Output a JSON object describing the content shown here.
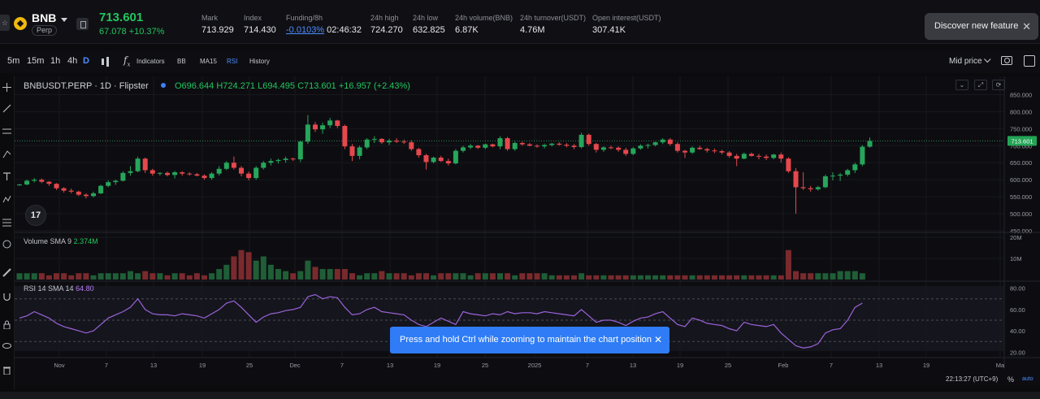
{
  "header": {
    "symbol": "BNB",
    "badge": "Perp",
    "last_price": "713.601",
    "change": "67.078 +10.37%",
    "stats": [
      {
        "label": "Mark",
        "value": "713.929"
      },
      {
        "label": "Index",
        "value": "714.430"
      },
      {
        "label": "Funding/8h",
        "value_link": "-0.0103%",
        "value": "02:46:32"
      },
      {
        "label": "24h high",
        "value": "724.270"
      },
      {
        "label": "24h low",
        "value": "632.825"
      },
      {
        "label": "24h volume(BNB)",
        "value": "6.87K"
      },
      {
        "label": "24h turnover(USDT)",
        "value": "4.76M"
      },
      {
        "label": "Open interest(USDT)",
        "value": "307.41K"
      }
    ],
    "discover": "Discover new feature"
  },
  "toolbar": {
    "intervals": [
      "5m",
      "15m",
      "1h",
      "4h",
      "D"
    ],
    "active_interval": "D",
    "indicators": "Indicators",
    "studies": [
      "BB",
      "MA15",
      "RSI"
    ],
    "active_study": "RSI",
    "history": "History",
    "mid_price": "Mid price"
  },
  "chart": {
    "title": "BNBUSDT.PERP · 1D · Flipster",
    "ohlc": {
      "o": "O696.644",
      "h": "H724.271",
      "l": "L694.495",
      "c": "C713.601",
      "chg": "+16.957 (+2.43%)"
    },
    "volume_label": "Volume SMA 9",
    "volume_value": "2.374M",
    "rsi_label": "RSI 14 SMA 14",
    "rsi_value": "64.80",
    "price_axis": [
      "850.000",
      "800.000",
      "750.000",
      "700.000",
      "650.000",
      "600.000",
      "550.000",
      "500.000",
      "450.000"
    ],
    "current_price_tag": "713.601",
    "volume_axis": [
      "20M",
      "10M"
    ],
    "rsi_axis": [
      "80.00",
      "60.00",
      "40.00",
      "20.00"
    ],
    "x_axis": [
      "Nov",
      "7",
      "13",
      "19",
      "25",
      "Dec",
      "7",
      "13",
      "19",
      "25",
      "2025",
      "7",
      "13",
      "19",
      "25",
      "Feb",
      "7",
      "13",
      "19",
      "Ma"
    ],
    "logo": "17"
  },
  "toast": {
    "text": "Press and hold Ctrl while zooming to maintain the chart position"
  },
  "bottom": {
    "time": "22:13:27 (UTC+9)",
    "percent": "%",
    "auto": "auto"
  },
  "colors": {
    "up": "#26a65b",
    "down": "#e5484d",
    "rsi": "#9b63d9",
    "accent": "#2f7cf6"
  },
  "chart_data": {
    "type": "candlestick",
    "candles": [
      [
        585,
        588,
        582,
        586
      ],
      [
        586,
        600,
        584,
        597
      ],
      [
        597,
        605,
        592,
        600
      ],
      [
        600,
        604,
        590,
        594
      ],
      [
        594,
        596,
        582,
        588
      ],
      [
        588,
        590,
        570,
        575
      ],
      [
        575,
        578,
        562,
        568
      ],
      [
        568,
        574,
        560,
        565
      ],
      [
        565,
        568,
        552,
        556
      ],
      [
        556,
        560,
        545,
        552
      ],
      [
        552,
        565,
        548,
        560
      ],
      [
        560,
        585,
        558,
        582
      ],
      [
        582,
        598,
        578,
        593
      ],
      [
        593,
        600,
        585,
        597
      ],
      [
        597,
        625,
        595,
        620
      ],
      [
        620,
        640,
        612,
        625
      ],
      [
        625,
        668,
        622,
        662
      ],
      [
        662,
        665,
        620,
        628
      ],
      [
        628,
        632,
        612,
        618
      ],
      [
        618,
        622,
        612,
        620
      ],
      [
        620,
        624,
        610,
        614
      ],
      [
        614,
        626,
        604,
        622
      ],
      [
        622,
        625,
        612,
        618
      ],
      [
        618,
        622,
        612,
        616
      ],
      [
        616,
        620,
        610,
        612
      ],
      [
        612,
        616,
        600,
        605
      ],
      [
        605,
        622,
        600,
        618
      ],
      [
        618,
        640,
        612,
        632
      ],
      [
        632,
        655,
        628,
        650
      ],
      [
        650,
        668,
        630,
        635
      ],
      [
        635,
        640,
        610,
        618
      ],
      [
        618,
        624,
        598,
        605
      ],
      [
        605,
        640,
        600,
        635
      ],
      [
        635,
        655,
        630,
        650
      ],
      [
        650,
        662,
        642,
        655
      ],
      [
        655,
        662,
        648,
        658
      ],
      [
        658,
        668,
        650,
        662
      ],
      [
        662,
        665,
        655,
        660
      ],
      [
        660,
        715,
        652,
        712
      ],
      [
        712,
        790,
        705,
        762
      ],
      [
        762,
        770,
        740,
        748
      ],
      [
        748,
        768,
        735,
        760
      ],
      [
        760,
        782,
        752,
        774
      ],
      [
        774,
        776,
        752,
        758
      ],
      [
        758,
        762,
        690,
        698
      ],
      [
        698,
        705,
        655,
        670
      ],
      [
        670,
        700,
        660,
        695
      ],
      [
        695,
        722,
        690,
        718
      ],
      [
        718,
        728,
        708,
        720
      ],
      [
        720,
        722,
        705,
        710
      ],
      [
        710,
        720,
        702,
        715
      ],
      [
        715,
        722,
        708,
        712
      ],
      [
        712,
        718,
        705,
        710
      ],
      [
        710,
        716,
        685,
        690
      ],
      [
        690,
        694,
        665,
        672
      ],
      [
        672,
        676,
        630,
        652
      ],
      [
        652,
        668,
        648,
        665
      ],
      [
        665,
        670,
        652,
        655
      ],
      [
        655,
        662,
        642,
        648
      ],
      [
        648,
        690,
        645,
        685
      ],
      [
        685,
        700,
        680,
        695
      ],
      [
        695,
        705,
        690,
        700
      ],
      [
        700,
        702,
        690,
        694
      ],
      [
        694,
        706,
        690,
        704
      ],
      [
        704,
        706,
        695,
        698
      ],
      [
        698,
        728,
        690,
        722
      ],
      [
        722,
        726,
        685,
        690
      ],
      [
        690,
        712,
        685,
        708
      ],
      [
        708,
        712,
        700,
        704
      ],
      [
        704,
        708,
        698,
        700
      ],
      [
        700,
        704,
        694,
        698
      ],
      [
        698,
        706,
        692,
        702
      ],
      [
        702,
        708,
        698,
        706
      ],
      [
        706,
        710,
        700,
        703
      ],
      [
        703,
        708,
        695,
        700
      ],
      [
        700,
        705,
        690,
        696
      ],
      [
        696,
        738,
        692,
        732
      ],
      [
        732,
        736,
        700,
        705
      ],
      [
        705,
        708,
        680,
        688
      ],
      [
        688,
        698,
        682,
        695
      ],
      [
        695,
        700,
        690,
        694
      ],
      [
        694,
        698,
        682,
        688
      ],
      [
        688,
        694,
        670,
        676
      ],
      [
        676,
        696,
        672,
        692
      ],
      [
        692,
        704,
        688,
        700
      ],
      [
        700,
        706,
        692,
        702
      ],
      [
        702,
        712,
        698,
        710
      ],
      [
        710,
        722,
        705,
        718
      ],
      [
        718,
        722,
        700,
        705
      ],
      [
        705,
        710,
        680,
        685
      ],
      [
        685,
        688,
        664,
        680
      ],
      [
        680,
        698,
        676,
        694
      ],
      [
        694,
        700,
        688,
        690
      ],
      [
        690,
        694,
        680,
        686
      ],
      [
        686,
        692,
        678,
        684
      ],
      [
        684,
        688,
        675,
        680
      ],
      [
        680,
        684,
        665,
        670
      ],
      [
        670,
        676,
        640,
        662
      ],
      [
        662,
        680,
        660,
        676
      ],
      [
        676,
        680,
        668,
        670
      ],
      [
        670,
        676,
        660,
        668
      ],
      [
        668,
        674,
        658,
        664
      ],
      [
        664,
        676,
        660,
        674
      ],
      [
        674,
        680,
        650,
        662
      ],
      [
        662,
        666,
        620,
        625
      ],
      [
        625,
        634,
        500,
        578
      ],
      [
        578,
        622,
        570,
        575
      ],
      [
        575,
        582,
        565,
        572
      ],
      [
        572,
        582,
        568,
        578
      ],
      [
        578,
        615,
        575,
        610
      ],
      [
        610,
        622,
        598,
        612
      ],
      [
        612,
        620,
        596,
        615
      ],
      [
        615,
        632,
        610,
        628
      ],
      [
        628,
        650,
        620,
        645
      ],
      [
        645,
        702,
        640,
        697
      ],
      [
        697,
        724,
        694,
        714
      ]
    ],
    "volume": [
      3,
      3,
      3,
      3,
      2,
      3,
      3,
      2,
      3,
      3,
      2,
      3,
      3,
      3,
      3,
      4,
      3,
      4,
      3,
      3,
      2,
      3,
      3,
      2,
      3,
      2,
      3,
      5,
      7,
      11,
      14,
      13,
      9,
      11,
      7,
      5,
      4,
      3,
      4,
      9,
      6,
      5,
      5,
      5,
      5,
      3,
      2,
      3,
      3,
      4,
      3,
      3,
      3,
      2,
      3,
      3,
      2,
      3,
      3,
      3,
      3,
      2,
      3,
      3,
      3,
      3,
      3,
      2,
      3,
      3,
      3,
      3,
      2,
      2,
      2,
      2,
      3,
      2,
      2,
      2,
      2,
      2,
      2,
      2,
      2,
      2,
      2,
      2,
      2,
      2,
      2,
      2,
      2,
      2,
      2,
      2,
      2,
      2,
      2,
      2,
      2,
      2,
      2,
      2,
      14,
      4,
      3,
      3,
      3,
      3,
      3,
      4,
      4,
      4,
      3
    ],
    "rsi": [
      52,
      54,
      58,
      55,
      52,
      47,
      44,
      42,
      40,
      38,
      40,
      46,
      52,
      55,
      58,
      62,
      70,
      60,
      56,
      55,
      55,
      54,
      56,
      55,
      54,
      52,
      56,
      60,
      66,
      68,
      62,
      55,
      48,
      53,
      56,
      57,
      59,
      60,
      62,
      72,
      74,
      70,
      72,
      71,
      62,
      55,
      56,
      60,
      62,
      58,
      57,
      56,
      55,
      50,
      46,
      44,
      48,
      52,
      49,
      46,
      58,
      56,
      55,
      54,
      56,
      55,
      58,
      56,
      57,
      57,
      56,
      58,
      57,
      56,
      55,
      54,
      60,
      54,
      48,
      50,
      50,
      48,
      45,
      49,
      52,
      53,
      56,
      58,
      52,
      46,
      44,
      52,
      50,
      47,
      46,
      45,
      42,
      40,
      48,
      46,
      45,
      44,
      46,
      38,
      32,
      26,
      24,
      25,
      28,
      38,
      41,
      42,
      50,
      62,
      66
    ],
    "ylim": [
      450,
      875
    ],
    "volume_ylim": [
      0,
      22
    ],
    "rsi_ylim": [
      15,
      85
    ]
  }
}
